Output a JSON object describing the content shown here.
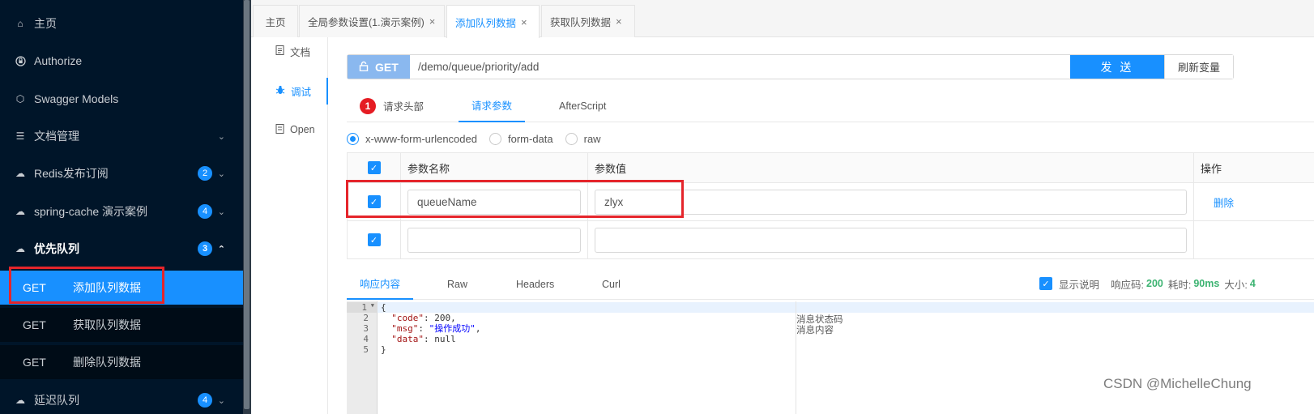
{
  "sidebar": {
    "items": [
      {
        "icon": "home-icon",
        "glyph": "⌂",
        "label": "主页"
      },
      {
        "icon": "lock-icon",
        "glyph": "🔒",
        "label": "Authorize"
      },
      {
        "icon": "cube-icon",
        "glyph": "⬡",
        "label": "Swagger Models"
      },
      {
        "icon": "doc-icon",
        "glyph": "☰",
        "label": "文档管理"
      },
      {
        "icon": "cloud-icon",
        "glyph": "☁",
        "label": "Redis发布订阅",
        "badge": "2"
      },
      {
        "icon": "cloud-icon",
        "glyph": "☁",
        "label": "spring-cache 演示案例",
        "badge": "4"
      },
      {
        "icon": "cloud-icon",
        "glyph": "☁",
        "label": "优先队列",
        "badge": "3"
      },
      {
        "icon": "cloud-icon",
        "glyph": "☁",
        "label": "延迟队列",
        "badge": "4"
      }
    ],
    "sub_items": [
      {
        "method": "GET",
        "label": "添加队列数据"
      },
      {
        "method": "GET",
        "label": "获取队列数据"
      },
      {
        "method": "GET",
        "label": "删除队列数据"
      }
    ]
  },
  "tabs": [
    {
      "label": "主页"
    },
    {
      "label": "全局参数设置(1.演示案例)",
      "close": "×"
    },
    {
      "label": "添加队列数据",
      "close": "×"
    },
    {
      "label": "获取队列数据",
      "close": "×"
    }
  ],
  "docnav": {
    "items": [
      {
        "icon": "document-icon",
        "label": "文档"
      },
      {
        "icon": "bug-icon",
        "label": "调试"
      },
      {
        "icon": "open-icon",
        "label": "Open"
      }
    ]
  },
  "request": {
    "method": "GET",
    "path": "/demo/queue/priority/add",
    "send_label": "发 送",
    "refresh_label": "刷新变量"
  },
  "req_tabs": {
    "header_count": "1",
    "header_label": "请求头部",
    "params_label": "请求参数",
    "after_label": "AfterScript"
  },
  "body_types": {
    "urlencoded": "x-www-form-urlencoded",
    "formdata": "form-data",
    "raw": "raw"
  },
  "params": {
    "headers": {
      "name": "参数名称",
      "value": "参数值",
      "action": "操作"
    },
    "rows": [
      {
        "name": "queueName",
        "value": "zlyx",
        "action": "删除"
      },
      {
        "name": "",
        "value": "",
        "action": ""
      }
    ]
  },
  "response": {
    "tabs": {
      "content": "响应内容",
      "raw": "Raw",
      "headers": "Headers",
      "curl": "Curl"
    },
    "show_desc": "显示说明",
    "code_label": "响应码:",
    "code": "200",
    "time_label": "耗时:",
    "time": "90ms",
    "size_label": "大小:",
    "size": "4"
  },
  "code_lines": {
    "l1": "{",
    "l2k": "\"code\"",
    "l2v": ": 200,",
    "l3k": "\"msg\"",
    "l3s": "\"操作成功\"",
    "l3e": ",",
    "l4k": "\"data\"",
    "l4v": ": null",
    "l5": "}"
  },
  "comments": {
    "code": "消息状态码",
    "msg": "消息内容"
  },
  "watermark": "CSDN @MichelleChung",
  "colors": {
    "accent": "#1890ff",
    "sidebar_bg": "#001529",
    "highlight": "#e5252b",
    "success": "#3cb371"
  }
}
